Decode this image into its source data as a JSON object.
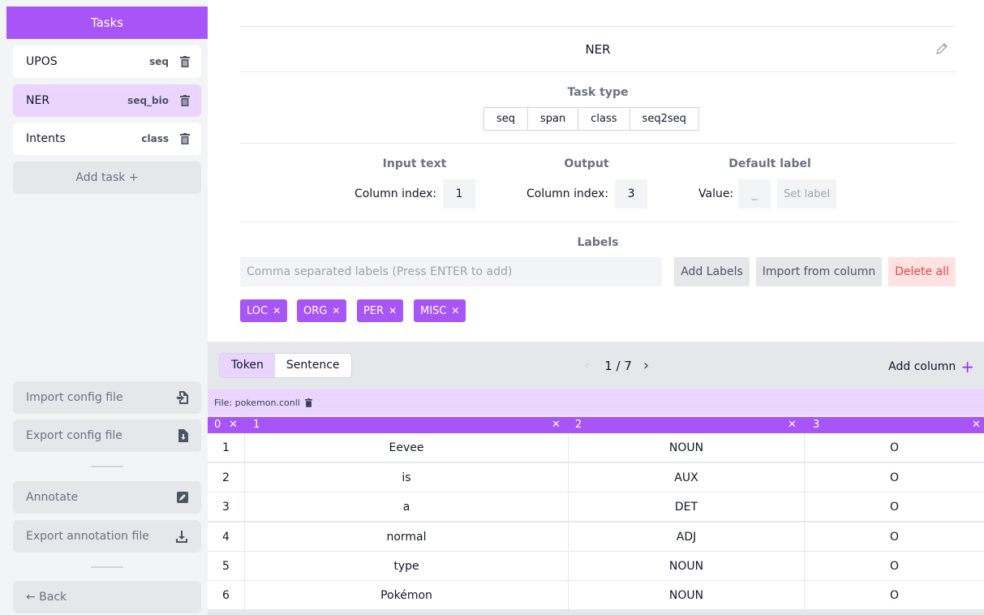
{
  "sidebar": {
    "title": "Tasks",
    "tasks": [
      {
        "name": "UPOS",
        "type": "seq"
      },
      {
        "name": "NER",
        "type": "seq_bio"
      },
      {
        "name": "Intents",
        "type": "class"
      }
    ],
    "add_task": "Add task +",
    "import_config": "Import config file",
    "export_config": "Export config file",
    "annotate": "Annotate",
    "export_annotation": "Export annotation file",
    "back": "← Back"
  },
  "task": {
    "name": "NER",
    "task_type_title": "Task type",
    "task_types": [
      "seq",
      "span",
      "class",
      "seq2seq"
    ],
    "input_title": "Input text",
    "input_label": "Column index:",
    "input_index": "1",
    "output_title": "Output",
    "output_label": "Column index:",
    "output_index": "3",
    "default_title": "Default label",
    "default_value_label": "Value:",
    "default_value": "_",
    "set_label": "Set label",
    "labels_title": "Labels",
    "labels_placeholder": "Comma separated labels (Press ENTER to add)",
    "add_labels": "Add Labels",
    "import_from_column": "Import from column",
    "delete_all": "Delete all",
    "labels": [
      "LOC",
      "ORG",
      "PER",
      "MISC"
    ]
  },
  "grid": {
    "view_tabs": [
      "Token",
      "Sentence"
    ],
    "active_view": "Token",
    "page": "1 / 7",
    "add_column": "Add column",
    "file_label": "File: pokemon.conll",
    "columns": [
      "0",
      "1",
      "2",
      "3"
    ],
    "rows": [
      [
        "1",
        "Eevee",
        "NOUN",
        "O"
      ],
      [
        "2",
        "is",
        "AUX",
        "O"
      ],
      [
        "3",
        "a",
        "DET",
        "O"
      ],
      [
        "4",
        "normal",
        "ADJ",
        "O"
      ],
      [
        "5",
        "type",
        "NOUN",
        "O"
      ],
      [
        "6",
        "Pokémon",
        "NOUN",
        "O"
      ]
    ]
  },
  "colors": {
    "accent": "#a855f7",
    "accent_light": "#e9d5ff",
    "danger_bg": "#fee2e2",
    "danger_text": "#ef4444"
  }
}
